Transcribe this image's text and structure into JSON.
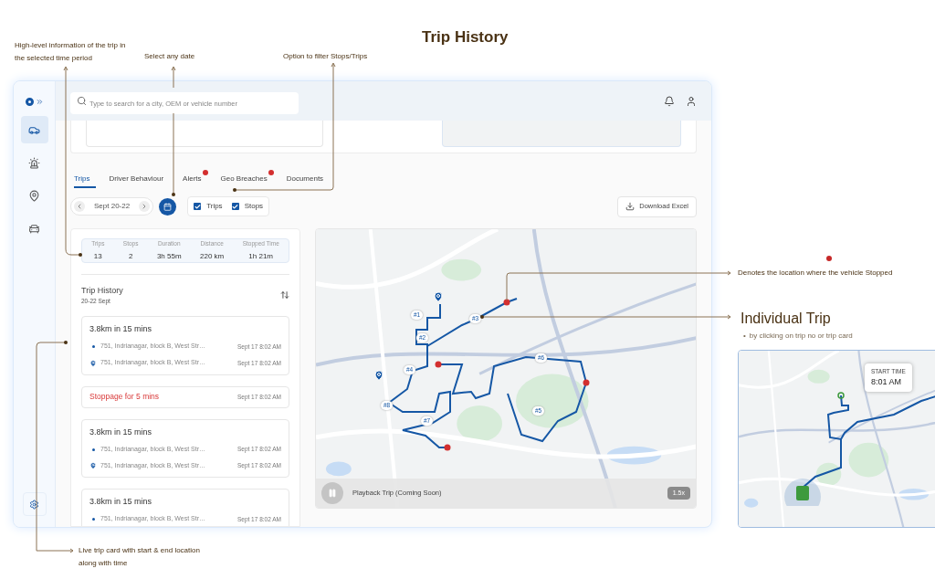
{
  "slide": {
    "title": "Trip History",
    "notes": {
      "summary": "High-level information of the trip in the selected time period",
      "date": "Select any date",
      "filter": "Option to filter Stops/Trips",
      "stopped": "Denotes the location where the vehicle Stopped",
      "live_card": "Live trip card with start & end location along with time"
    },
    "individual_trip": {
      "heading": "Individual Trip",
      "bullet": "•",
      "text": "by clicking on trip no or trip card",
      "callout_label": "START TIME",
      "callout_time": "8:01 AM"
    }
  },
  "app": {
    "search": {
      "placeholder": "Type to search for a city, OEM or vehicle number"
    },
    "sidebar": [
      {
        "kind": "car",
        "selected": true
      },
      {
        "kind": "alarm",
        "selected": false
      },
      {
        "kind": "location",
        "selected": false
      },
      {
        "kind": "vehicle",
        "selected": false
      }
    ],
    "tabs": [
      {
        "label": "Trips",
        "selected": true,
        "alert": false
      },
      {
        "label": "Driver Behaviour",
        "selected": false,
        "alert": false
      },
      {
        "label": "Alerts",
        "selected": false,
        "alert": true
      },
      {
        "label": "Geo Breaches",
        "selected": false,
        "alert": true
      },
      {
        "label": "Documents",
        "selected": false,
        "alert": false
      }
    ],
    "date_range": "Sept 20-22",
    "filters": [
      {
        "label": "Trips",
        "checked": true
      },
      {
        "label": "Stops",
        "checked": true
      }
    ],
    "download": "Download Excel",
    "stats": [
      {
        "label": "Trips",
        "value": "13"
      },
      {
        "label": "Stops",
        "value": "2"
      },
      {
        "label": "Duration",
        "value": "3h 55m"
      },
      {
        "label": "Distance",
        "value": "220 km"
      },
      {
        "label": "Stopped Time",
        "value": "1h 21m"
      }
    ],
    "history": {
      "title": "Trip History",
      "subtitle": "20-22 Sept",
      "items": [
        {
          "kind": "trip",
          "title": "3.8km in 15 mins",
          "stops": [
            {
              "address": "751, Indrianagar, block B, West Str…",
              "time": "Sept 17 8:02 AM"
            },
            {
              "address": "751, Indrianagar, block B, West Str…",
              "time": "Sept 17 8:02 AM"
            }
          ]
        },
        {
          "kind": "stoppage",
          "title": "Stoppage for 5 mins",
          "time": "Sept 17 8:02 AM"
        },
        {
          "kind": "trip",
          "title": "3.8km in 15 mins",
          "stops": [
            {
              "address": "751, Indrianagar, block B, West Str…",
              "time": "Sept 17 8:02 AM"
            },
            {
              "address": "751, Indrianagar, block B, West Str…",
              "time": "Sept 17 8:02 AM"
            }
          ]
        },
        {
          "kind": "trip",
          "title": "3.8km in 15 mins",
          "stops": [
            {
              "address": "751, Indrianagar, block B, West Str…",
              "time": "Sept 17 8:02 AM"
            }
          ]
        }
      ]
    },
    "map": {
      "trip_labels": [
        "#1",
        "#2",
        "#3",
        "#4",
        "#5",
        "#6",
        "#7",
        "#8"
      ],
      "playback": "Playback Trip (Coming Soon)",
      "speed": "1.5x"
    }
  }
}
